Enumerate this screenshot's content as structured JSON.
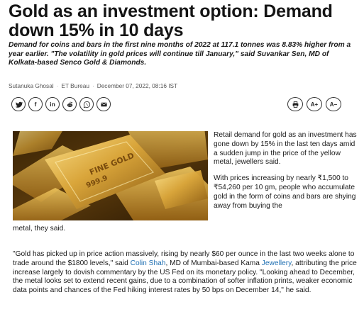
{
  "article": {
    "title": "Gold as an investment option: Demand down 15% in 10 days",
    "summary": "Demand for coins and bars in the first nine months of 2022 at 117.1 tonnes was 8.83% higher from a year earlier. \"The volatility in gold prices will continue till January,\" said Suvankar Sen, MD of Kolkata-based Senco Gold & Diamonds.",
    "author": "Sutanuka Ghosal",
    "source": "ET Bureau",
    "date": "December 07, 2022, 08:16 IST"
  },
  "share": {
    "items": [
      {
        "name": "twitter-icon"
      },
      {
        "name": "facebook-icon",
        "glyph": "f"
      },
      {
        "name": "linkedin-icon",
        "glyph": "in"
      },
      {
        "name": "reddit-icon"
      },
      {
        "name": "whatsapp-icon"
      },
      {
        "name": "email-icon"
      }
    ]
  },
  "tools": {
    "print_icon": "print-icon",
    "font_increase_label": "A+",
    "font_decrease_label": "A−"
  },
  "image": {
    "bar_text_1": "FINE GOLD",
    "bar_text_2": "999.9"
  },
  "body": {
    "para1": "Retail demand for gold as an investment has gone down by 15% in the last ten days amid a sudden jump in the price of the yellow metal, jewellers said.",
    "para2_side": "With prices increasing by nearly ₹1,500 to ₹54,260 per 10 gm, people who accumulate gold in the form of coins and bars are shying away from buying the",
    "para2_tail": "metal, they said.",
    "para3_start": "\"Gold has picked up in price action massively, rising by nearly $60 per ounce in the last two weeks alone to trade around the $1800 levels,\" said ",
    "para3_link1": "Colin Shah",
    "para3_mid": ", MD of Mumbai-based Kama ",
    "para3_link2": "Jewellery",
    "para3_end": ", attributing the price increase largely to dovish commentary by the US Fed on its monetary policy. \"Looking ahead to December, the metal looks set to extend recent gains, due to a combination of softer inflation prints, weaker economic data points and chances of the Fed hiking interest rates by 50 bps on December 14,\" he said."
  },
  "colors": {
    "link": "#1f6fb2",
    "gold": "#c9942e",
    "text": "#1a1a1a"
  }
}
